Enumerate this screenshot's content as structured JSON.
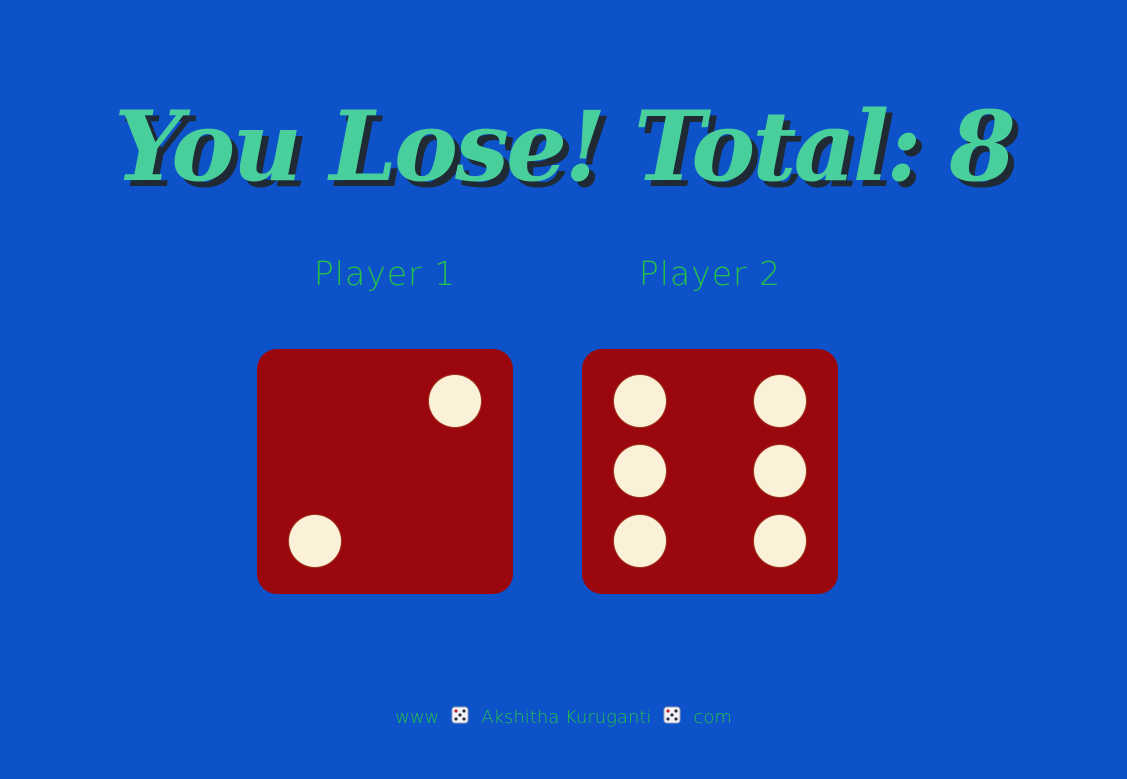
{
  "result": {
    "message": "You Lose! Total: 8"
  },
  "players": [
    {
      "label": "Player 1",
      "value": 2
    },
    {
      "label": "Player 2",
      "value": 6
    }
  ],
  "footer": {
    "prefix": "www",
    "name": "Akshitha Kuruganti",
    "suffix": "com",
    "separator_icon": "game-die-icon"
  },
  "colors": {
    "background": "#0d52c9",
    "headline": "#49cf9b",
    "headline_shadow": "#1f2a35",
    "player_label": "#27c04a",
    "die_face": "#9a070d",
    "pip": "#fbf1d8",
    "footer_text": "#27c04a"
  }
}
